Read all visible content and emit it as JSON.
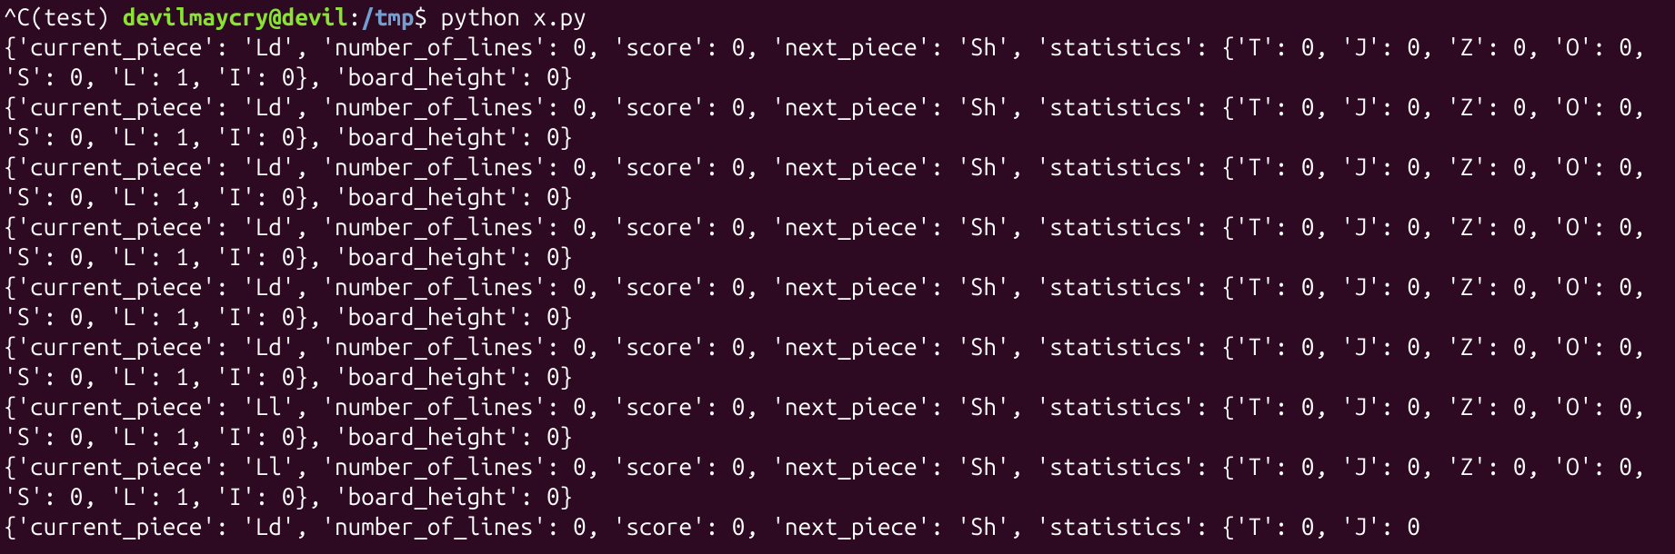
{
  "prompt": {
    "interrupt": "^C",
    "env": "(test) ",
    "user_host": "devilmaycry@devil",
    "sep": ":",
    "path": "/tmp",
    "dollar": "$ ",
    "command": "python x.py"
  },
  "output_lines": [
    "{'current_piece': 'Ld', 'number_of_lines': 0, 'score': 0, 'next_piece': 'Sh', 'statistics': {'T': 0, 'J': 0, 'Z': 0, 'O': 0, 'S': 0, 'L': 1, 'I': 0}, 'board_height': 0}",
    "{'current_piece': 'Ld', 'number_of_lines': 0, 'score': 0, 'next_piece': 'Sh', 'statistics': {'T': 0, 'J': 0, 'Z': 0, 'O': 0, 'S': 0, 'L': 1, 'I': 0}, 'board_height': 0}",
    "{'current_piece': 'Ld', 'number_of_lines': 0, 'score': 0, 'next_piece': 'Sh', 'statistics': {'T': 0, 'J': 0, 'Z': 0, 'O': 0, 'S': 0, 'L': 1, 'I': 0}, 'board_height': 0}",
    "{'current_piece': 'Ld', 'number_of_lines': 0, 'score': 0, 'next_piece': 'Sh', 'statistics': {'T': 0, 'J': 0, 'Z': 0, 'O': 0, 'S': 0, 'L': 1, 'I': 0}, 'board_height': 0}",
    "{'current_piece': 'Ld', 'number_of_lines': 0, 'score': 0, 'next_piece': 'Sh', 'statistics': {'T': 0, 'J': 0, 'Z': 0, 'O': 0, 'S': 0, 'L': 1, 'I': 0}, 'board_height': 0}",
    "{'current_piece': 'Ld', 'number_of_lines': 0, 'score': 0, 'next_piece': 'Sh', 'statistics': {'T': 0, 'J': 0, 'Z': 0, 'O': 0, 'S': 0, 'L': 1, 'I': 0}, 'board_height': 0}",
    "{'current_piece': 'Ll', 'number_of_lines': 0, 'score': 0, 'next_piece': 'Sh', 'statistics': {'T': 0, 'J': 0, 'Z': 0, 'O': 0, 'S': 0, 'L': 1, 'I': 0}, 'board_height': 0}",
    "{'current_piece': 'Ll', 'number_of_lines': 0, 'score': 0, 'next_piece': 'Sh', 'statistics': {'T': 0, 'J': 0, 'Z': 0, 'O': 0, 'S': 0, 'L': 1, 'I': 0}, 'board_height': 0}",
    "{'current_piece': 'Ld', 'number_of_lines': 0, 'score': 0, 'next_piece': 'Sh', 'statistics': {'T': 0, 'J': 0"
  ],
  "watermark": ""
}
